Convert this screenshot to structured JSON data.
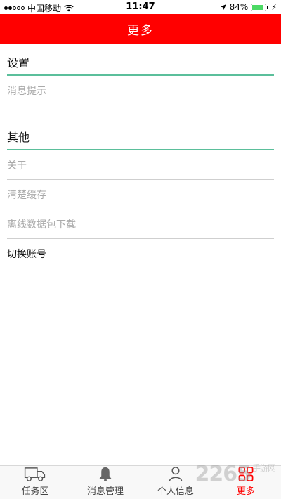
{
  "status_bar": {
    "carrier": "中国移动",
    "time": "11:47",
    "battery": "84%",
    "battery_level": 0.84
  },
  "header": {
    "title": "更多"
  },
  "sections": [
    {
      "title": "设置",
      "items": [
        {
          "label": "消息提示"
        }
      ]
    },
    {
      "title": "其他",
      "items": [
        {
          "label": "关于"
        },
        {
          "label": "清楚缓存"
        },
        {
          "label": "离线数据包下载"
        },
        {
          "label": "切换账号"
        }
      ]
    }
  ],
  "tabs": [
    {
      "label": "任务区",
      "icon": "truck-icon"
    },
    {
      "label": "消息管理",
      "icon": "bell-icon"
    },
    {
      "label": "个人信息",
      "icon": "person-icon"
    },
    {
      "label": "更多",
      "icon": "grid-icon",
      "active": true
    }
  ],
  "watermark": {
    "number": "2265",
    "text": "手游网"
  },
  "colors": {
    "accent": "#ff0000",
    "divider_accent": "#5bbf9b"
  }
}
